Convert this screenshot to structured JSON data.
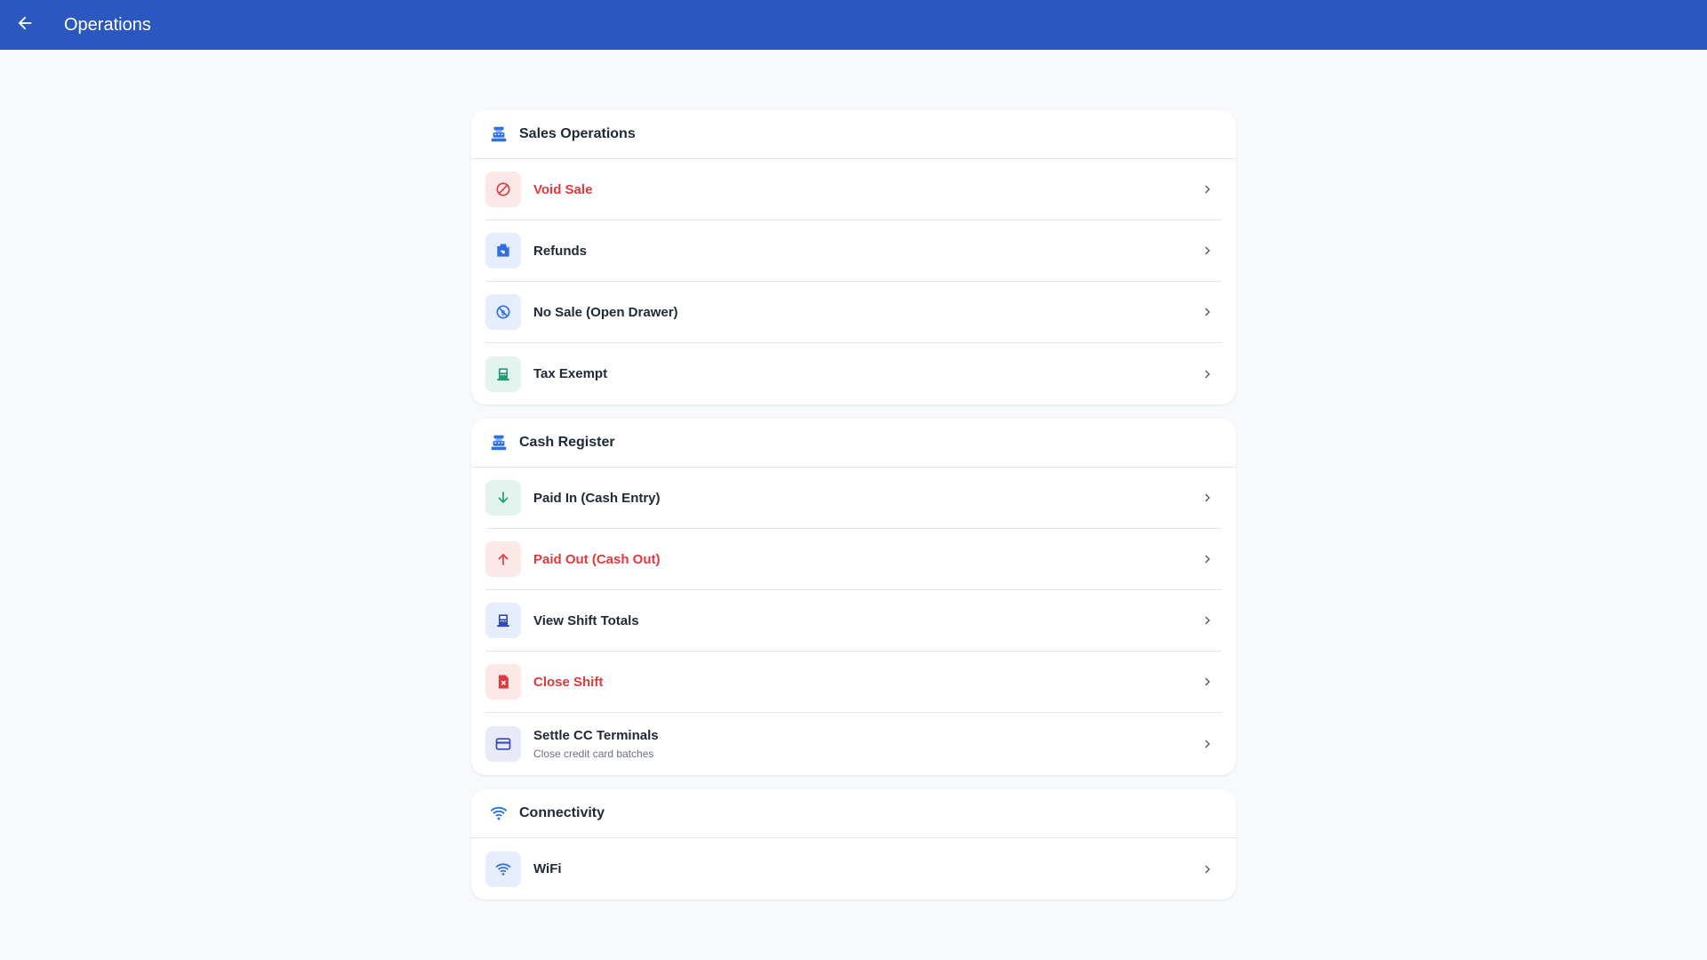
{
  "appbar": {
    "title": "Operations",
    "back_icon": "arrow-left-icon"
  },
  "colors": {
    "primary": "#2b58c0",
    "danger": "#e0393e",
    "success": "#1f9d73",
    "accent_blue": "#2f6fe0"
  },
  "sections": [
    {
      "title": "Sales Operations",
      "icon": "cash-register-icon",
      "items": [
        {
          "label": "Void Sale",
          "icon": "cancel-icon",
          "tone": "danger"
        },
        {
          "label": "Refunds",
          "icon": "return-icon",
          "tone": "normal"
        },
        {
          "label": "No Sale (Open Drawer)",
          "icon": "no-money-icon",
          "tone": "normal"
        },
        {
          "label": "Tax Exempt",
          "icon": "receipt-icon",
          "tone": "normal"
        }
      ]
    },
    {
      "title": "Cash Register",
      "icon": "cash-register-icon",
      "items": [
        {
          "label": "Paid In (Cash Entry)",
          "icon": "arrow-down-icon",
          "tone": "normal"
        },
        {
          "label": "Paid Out (Cash Out)",
          "icon": "arrow-up-icon",
          "tone": "danger"
        },
        {
          "label": "View Shift Totals",
          "icon": "receipt-icon",
          "tone": "normal"
        },
        {
          "label": "Close Shift",
          "icon": "close-document-icon",
          "tone": "danger"
        },
        {
          "label": "Settle CC Terminals",
          "sublabel": "Close credit card batches",
          "icon": "credit-card-icon",
          "tone": "normal"
        }
      ]
    },
    {
      "title": "Connectivity",
      "icon": "wifi-icon",
      "items": [
        {
          "label": "WiFi",
          "icon": "wifi-icon",
          "tone": "normal"
        }
      ]
    }
  ]
}
